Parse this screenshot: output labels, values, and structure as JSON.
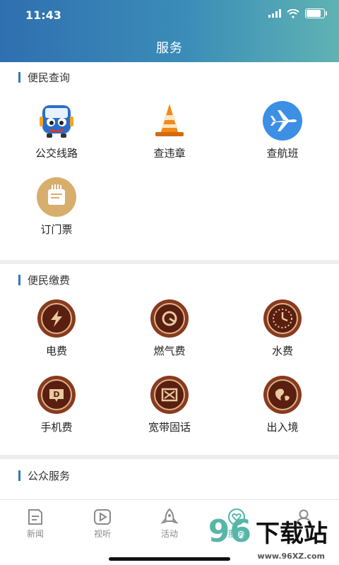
{
  "status_bar": {
    "time": "11:43"
  },
  "header": {
    "title": "服务"
  },
  "sections": [
    {
      "title": "便民查询",
      "items": [
        {
          "label": "公交线路",
          "icon": "bus-icon"
        },
        {
          "label": "查违章",
          "icon": "traffic-cone-icon"
        },
        {
          "label": "查航班",
          "icon": "airplane-icon"
        },
        {
          "label": "订门票",
          "icon": "ticket-icon"
        }
      ]
    },
    {
      "title": "便民缴费",
      "items": [
        {
          "label": "电费",
          "icon": "electricity-icon"
        },
        {
          "label": "燃气费",
          "icon": "gas-icon"
        },
        {
          "label": "水费",
          "icon": "water-clock-icon"
        },
        {
          "label": "手机费",
          "icon": "phone-bill-icon"
        },
        {
          "label": "宽带固话",
          "icon": "broadband-icon"
        },
        {
          "label": "出入境",
          "icon": "globe-icon"
        }
      ]
    },
    {
      "title": "公众服务",
      "items": [
        {
          "label": "",
          "icon": "person-icon"
        },
        {
          "label": "",
          "icon": "taxi-icon"
        },
        {
          "label": "",
          "icon": "house-icon"
        }
      ]
    }
  ],
  "tabbar": {
    "items": [
      {
        "label": "新闻",
        "icon": "news-icon"
      },
      {
        "label": "视听",
        "icon": "play-icon"
      },
      {
        "label": "活动",
        "icon": "rocket-icon"
      },
      {
        "label": "服务",
        "icon": "heart-icon"
      },
      {
        "label": "",
        "icon": "user-icon"
      }
    ]
  },
  "watermark": {
    "number": "96",
    "text": "下载站",
    "url": "www.96XZ.com"
  },
  "colors": {
    "header_start": "#2f6fb0",
    "header_end": "#5fb3b3",
    "accent": "#2f78c2",
    "brown": "#6b2a16"
  }
}
